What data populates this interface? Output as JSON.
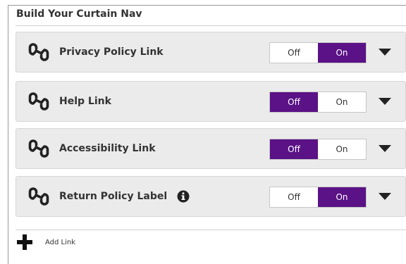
{
  "panel": {
    "title": "Build Your Curtain Nav"
  },
  "rows": [
    {
      "label": "Privacy Policy Link",
      "icon": "link-icon",
      "off_label": "Off",
      "on_label": "On",
      "value": "On"
    },
    {
      "label": "Help Link",
      "icon": "link-icon",
      "off_label": "Off",
      "on_label": "On",
      "value": "Off"
    },
    {
      "label": "Accessibility Link",
      "icon": "link-icon",
      "off_label": "Off",
      "on_label": "On",
      "value": "Off"
    },
    {
      "label": "Return Policy Label",
      "icon": "link-icon",
      "has_info": true,
      "off_label": "Off",
      "on_label": "On",
      "value": "On"
    }
  ],
  "add_link": {
    "label": "Add Link",
    "icon": "plus-icon"
  },
  "colors": {
    "accent": "#5a1286",
    "row_background": "#ebebeb"
  }
}
